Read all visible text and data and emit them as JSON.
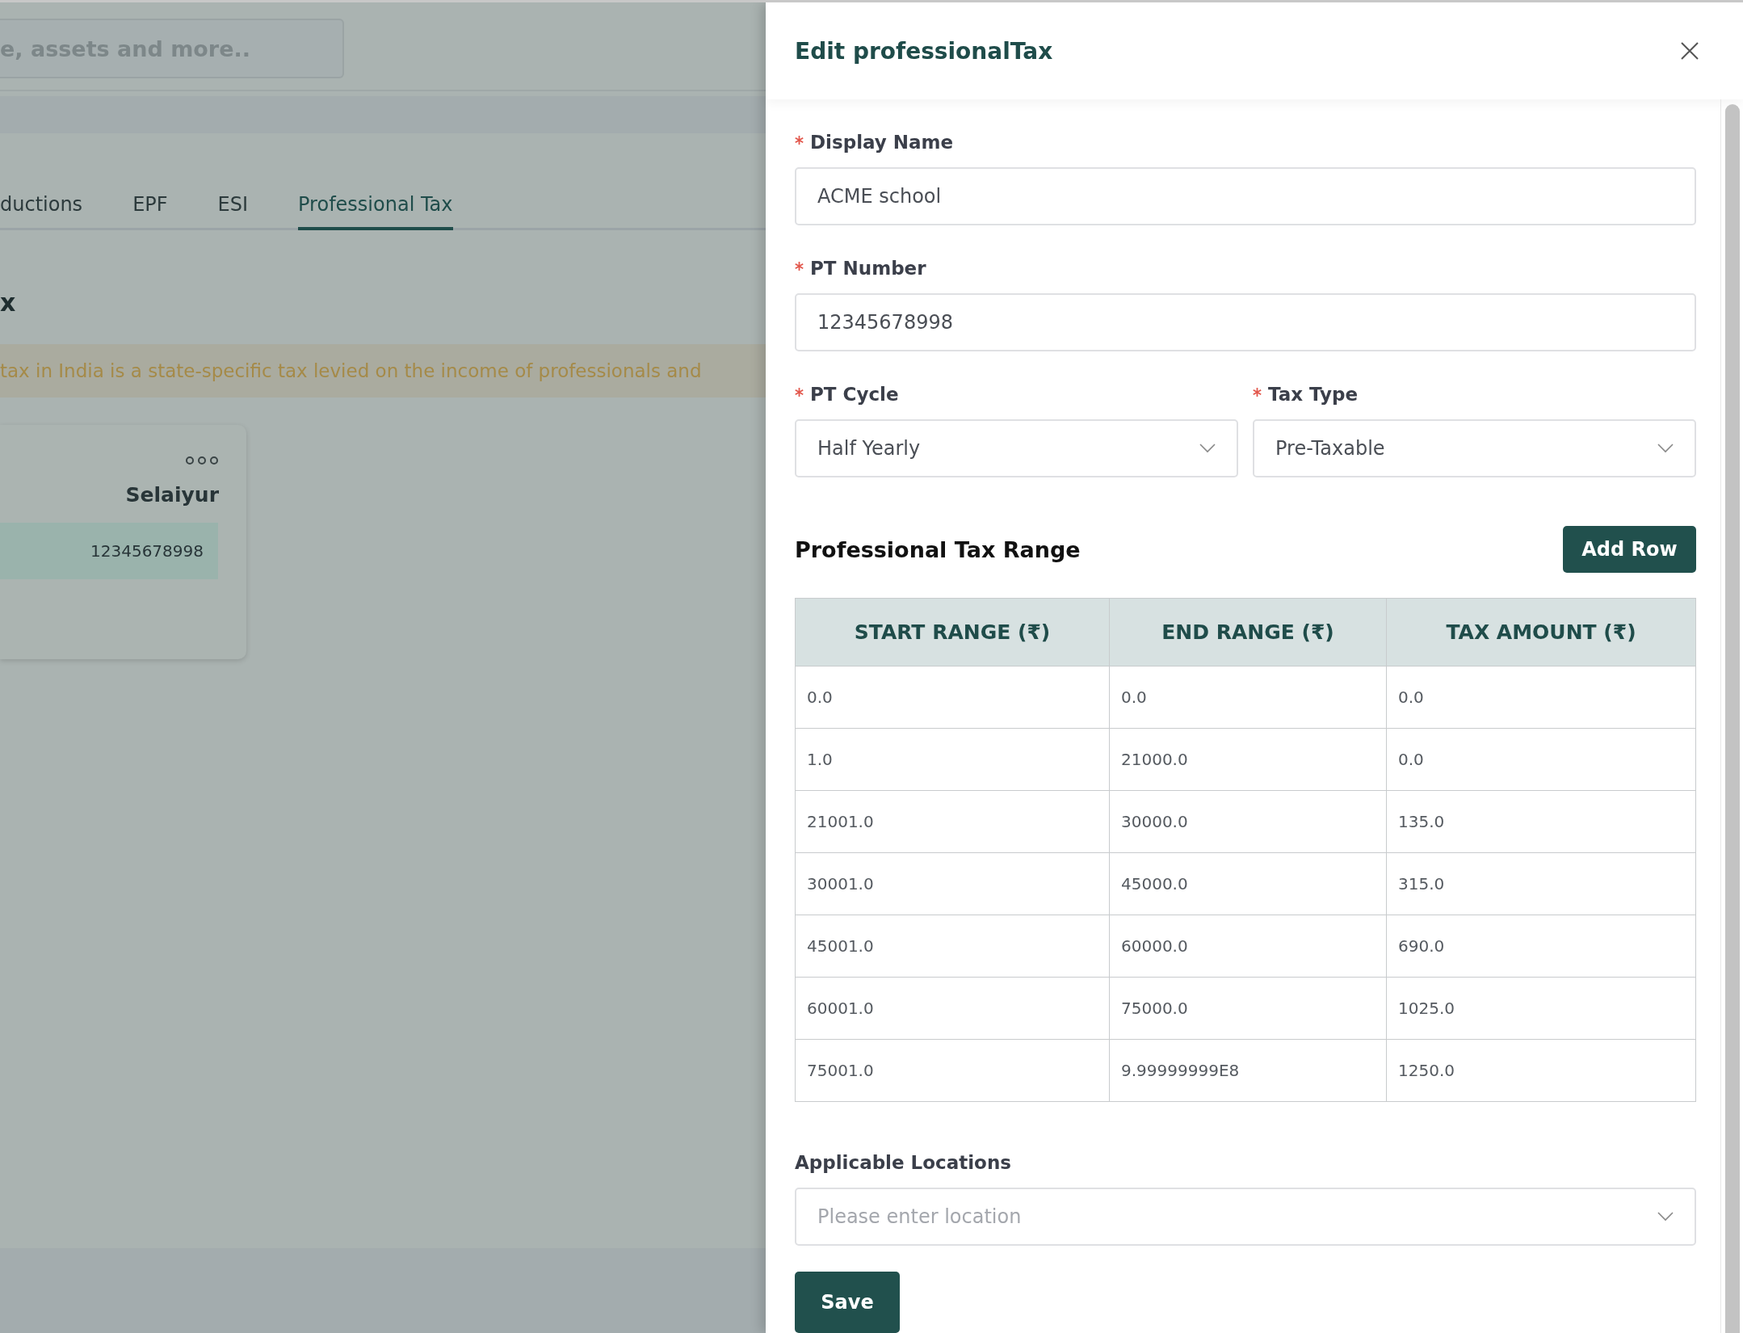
{
  "background": {
    "search": {
      "placeholder": "e, assets and more.."
    },
    "tabs": [
      {
        "label": "ductions",
        "selected": false
      },
      {
        "label": "EPF",
        "selected": false
      },
      {
        "label": "ESI",
        "selected": false
      },
      {
        "label": "Professional Tax",
        "selected": true
      }
    ],
    "heading": "x",
    "banner": "tax in India is a state-specific tax levied on the income of professionals and",
    "card": {
      "title": "Selaiyur",
      "pt_number": "12345678998"
    }
  },
  "drawer": {
    "title": "Edit professionalTax",
    "field_rows": [
      [
        {
          "label": "Display Name",
          "required": true,
          "kind": "input",
          "value": "ACME school"
        }
      ],
      [
        {
          "label": "PT Number",
          "required": true,
          "kind": "input",
          "value": "12345678998"
        }
      ],
      [
        {
          "label": "PT Cycle",
          "required": true,
          "kind": "select",
          "value": "Half Yearly"
        },
        {
          "label": "Tax Type",
          "required": true,
          "kind": "select",
          "value": "Pre-Taxable"
        }
      ]
    ],
    "range_title": "Professional Tax Range",
    "add_button": "Add Row",
    "table": {
      "columns": [
        "START RANGE (₹)",
        "END RANGE (₹)",
        "TAX AMOUNT (₹)"
      ],
      "rows": [
        [
          "0.0",
          "0.0",
          "0.0"
        ],
        [
          "1.0",
          "21000.0",
          "0.0"
        ],
        [
          "21001.0",
          "30000.0",
          "135.0"
        ],
        [
          "30001.0",
          "45000.0",
          "315.0"
        ],
        [
          "45001.0",
          "60000.0",
          "690.0"
        ],
        [
          "60001.0",
          "75000.0",
          "1025.0"
        ],
        [
          "75001.0",
          "9.99999999E8",
          "1250.0"
        ]
      ]
    },
    "locations": {
      "label": "Applicable Locations",
      "kind": "select",
      "placeholder": "Please enter location"
    },
    "save_button": "Save"
  }
}
